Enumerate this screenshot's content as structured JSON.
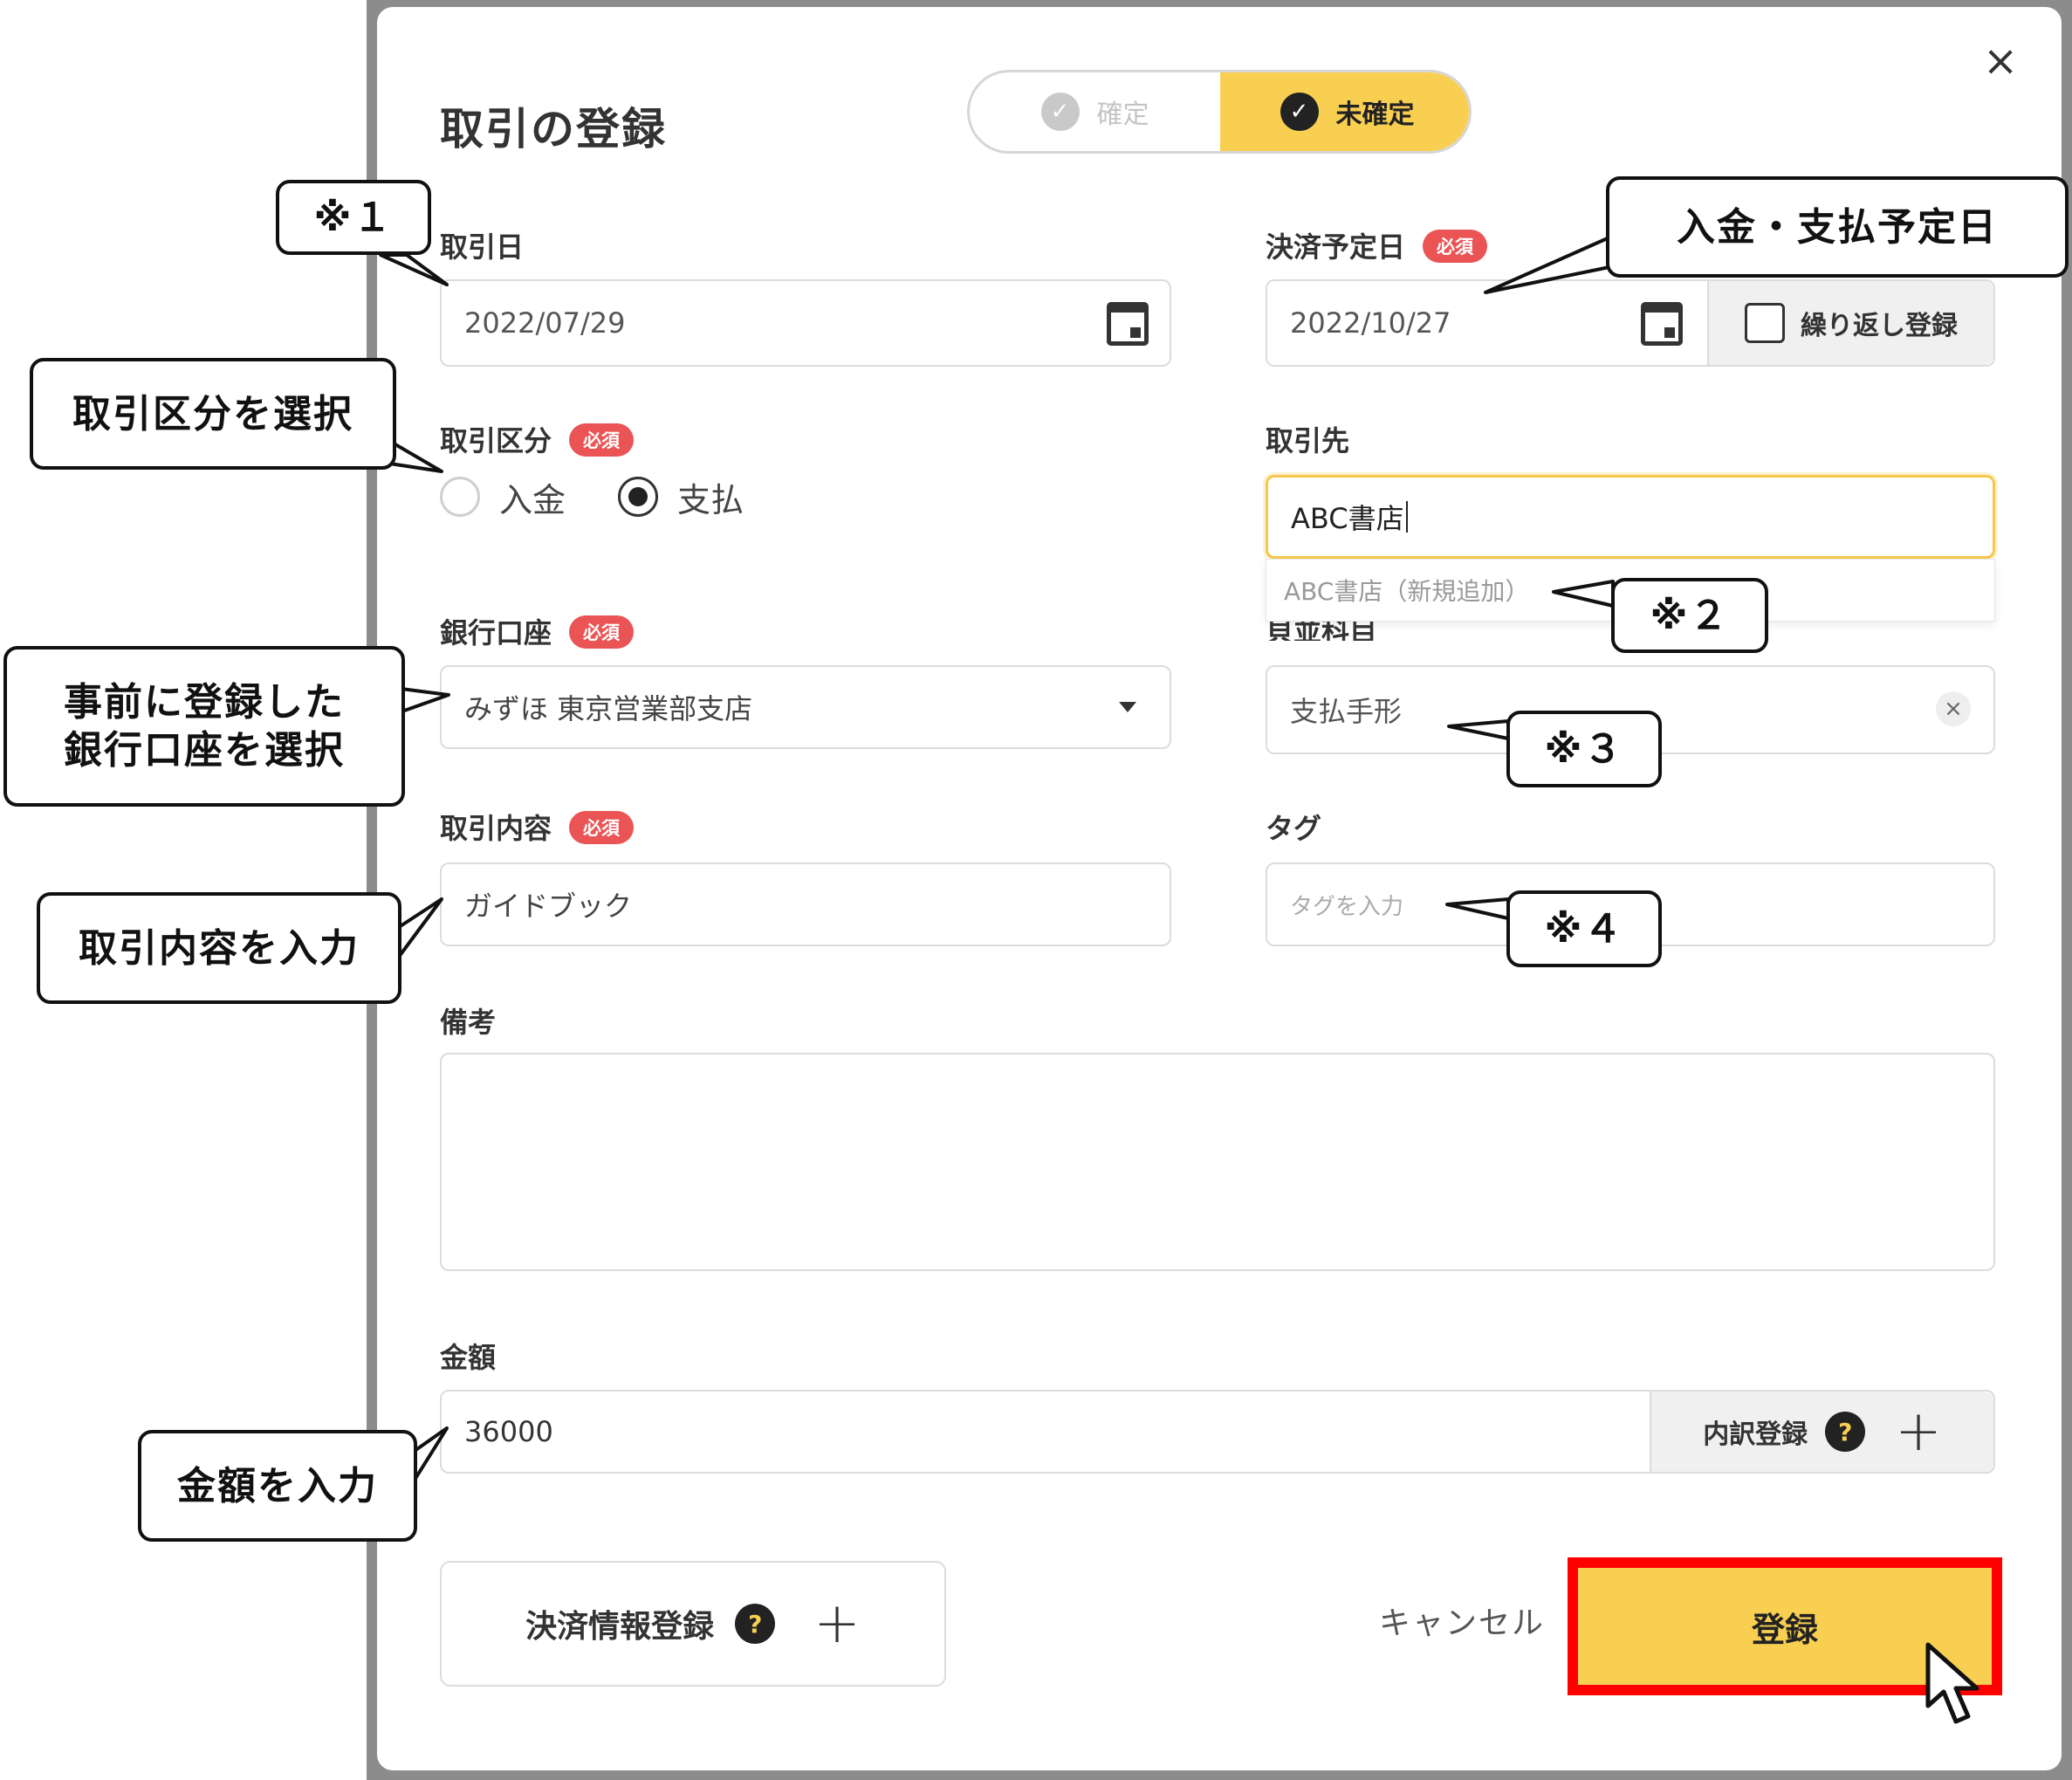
{
  "dialog": {
    "title": "取引の登録",
    "status_toggle": {
      "confirmed": "確定",
      "unconfirmed": "未確定",
      "selected": "unconfirmed"
    },
    "close_glyph": "×"
  },
  "fields": {
    "transaction_date": {
      "label": "取引日",
      "value": "2022/07/29"
    },
    "settlement_date": {
      "label": "決済予定日",
      "required": "必須",
      "value": "2022/10/27",
      "repeat_label": "繰り返し登録"
    },
    "transaction_type": {
      "label": "取引区分",
      "required": "必須",
      "options": [
        "入金",
        "支払"
      ],
      "selected": "支払"
    },
    "partner": {
      "label": "取引先",
      "value": "ABC書店",
      "suggestion": "ABC書店（新規追加）"
    },
    "bank_account": {
      "label": "銀行口座",
      "required": "必須",
      "value": "みずほ 東京営業部支店"
    },
    "account_item": {
      "label_partial": "貝並科目",
      "value": "支払手形",
      "clear_glyph": "×"
    },
    "description": {
      "label": "取引内容",
      "required": "必須",
      "value": "ガイドブック"
    },
    "tags": {
      "label": "タグ",
      "placeholder": "タグを入力"
    },
    "memo": {
      "label": "備考",
      "value": ""
    },
    "amount": {
      "label": "金額",
      "value": "36000",
      "breakdown_label": "内訳登録",
      "help_glyph": "?",
      "plus_glyph": "+"
    }
  },
  "actions": {
    "settlement_info": "決済情報登録",
    "help_glyph": "?",
    "plus_glyph": "+",
    "cancel": "キャンセル",
    "submit": "登録"
  },
  "callouts": {
    "note1": "※１",
    "payment_date": "入金・支払予定日",
    "select_type": "取引区分を選択",
    "note2": "※２",
    "bank_line1": "事前に登録した",
    "bank_line2": "銀行口座を選択",
    "note3": "※３",
    "enter_description": "取引内容を入力",
    "note4": "※４",
    "enter_amount": "金額を入力"
  },
  "colors": {
    "accent": "#f9cf52",
    "required_badge": "#ea5455",
    "highlight_border": "#ff0000"
  }
}
